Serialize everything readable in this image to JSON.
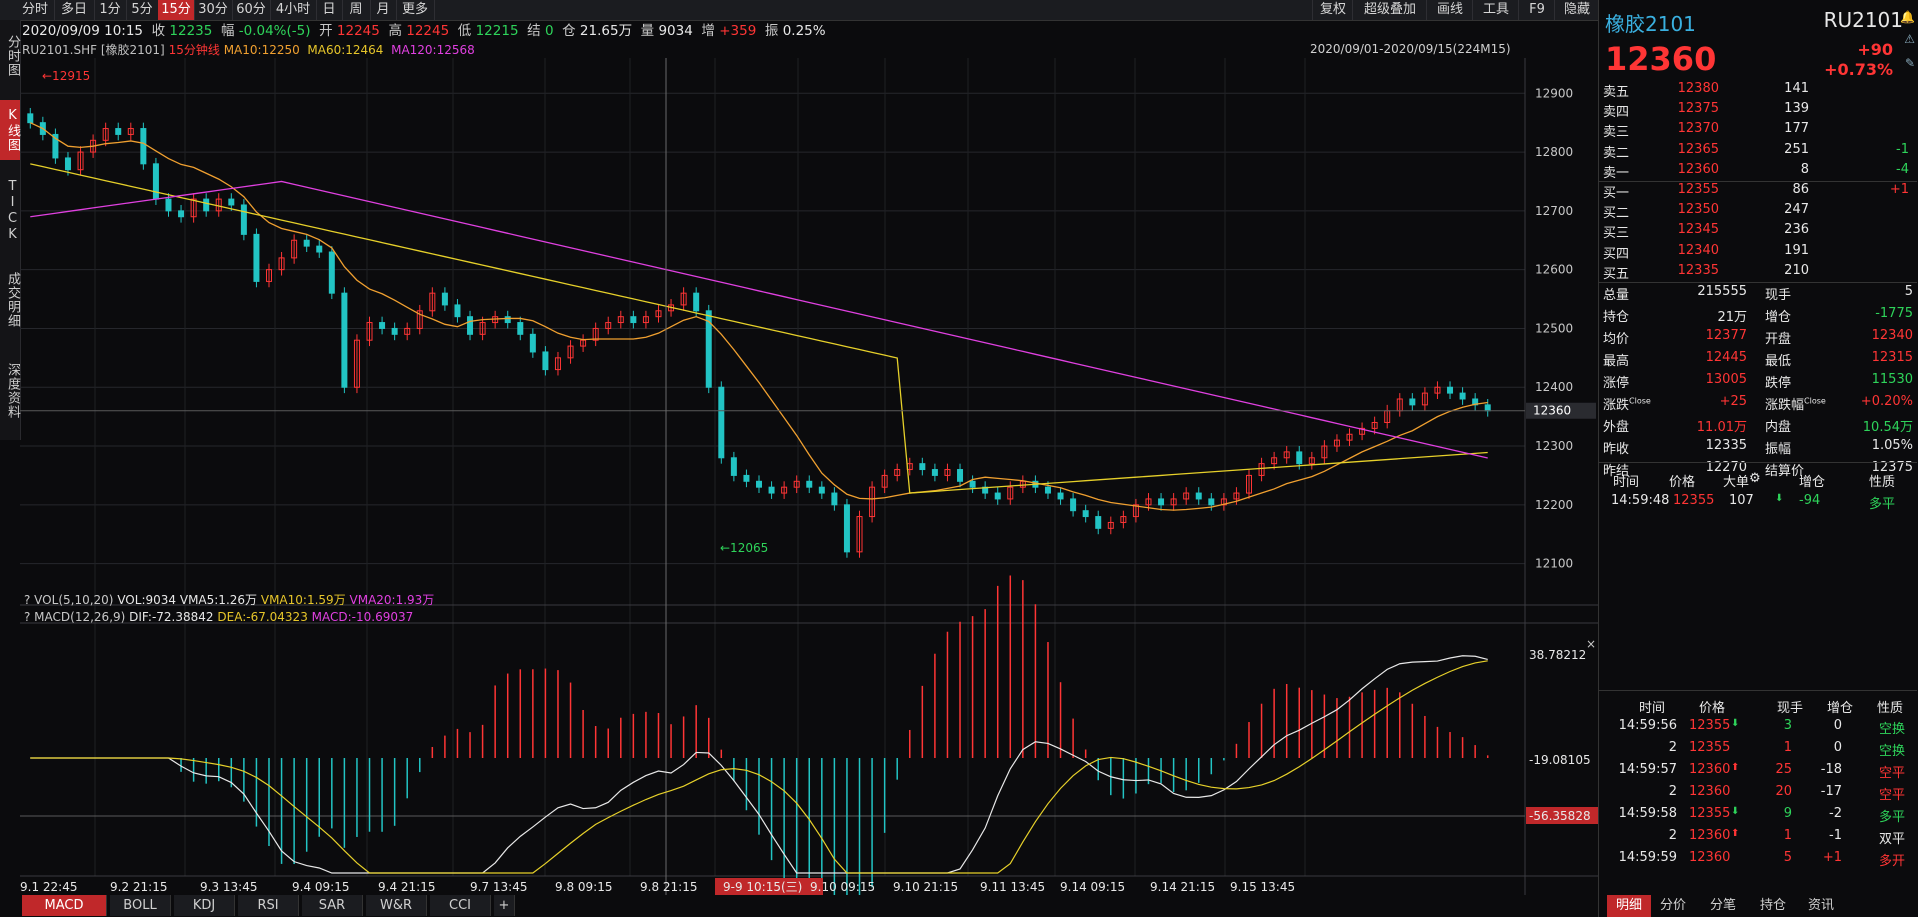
{
  "toolbar": {
    "periods": [
      "分时",
      "多日",
      "1分",
      "5分",
      "15分",
      "30分",
      "60分",
      "4小时",
      "日",
      "周",
      "月",
      "更多"
    ],
    "active_period": "15分",
    "right_buttons": [
      "复权",
      "超级叠加",
      "画线",
      "工具",
      "F9",
      "隐藏"
    ]
  },
  "quote": {
    "datetime": "2020/09/09 10:15",
    "close_label": "收",
    "close": "12235",
    "range_label": "幅",
    "change": "-0.04%(-5)",
    "open_label": "开",
    "open": "12245",
    "high_label": "高",
    "high": "12245",
    "low_label": "低",
    "low": "12215",
    "settle_label": "结",
    "settle": "0",
    "oi_label": "仓",
    "oi": "21.65万",
    "vol_label": "量",
    "vol": "9034",
    "inc_label": "增",
    "inc": "+359",
    "amp_label": "振",
    "amp": "0.25%"
  },
  "legend": {
    "symbol": "RU2101.SHF [橡胶2101]",
    "period": "15分钟线",
    "ma10": "MA10:12250",
    "ma60": "MA60:12464",
    "ma120": "MA120:12568",
    "range": "2020/09/01-2020/09/15(224M15)"
  },
  "vtabs": [
    "分时图",
    "K线图",
    "TICK",
    "成交明细",
    "深度资料"
  ],
  "vol_legend": {
    "name": "VOL(5,10,20)",
    "vol": "VOL:9034",
    "vma5": "VMA5:1.26万",
    "vma10": "VMA10:1.59万",
    "vma20": "VMA20:1.93万"
  },
  "macd_legend": {
    "name": "MACD(12,26,9)",
    "dif": "DIF:-72.38842",
    "dea": "DEA:-67.04323",
    "macd": "MACD:-10.69037"
  },
  "colors": {
    "up": "#ff3535",
    "down": "#22c4c4",
    "ma10": "#f0a030",
    "ma60": "#e6d02a",
    "ma120": "#e040e0",
    "accent": "#c0282a"
  },
  "chart_data": {
    "type": "candlestick",
    "price_axis": {
      "min": 12050,
      "max": 12960,
      "ticks": [
        12900,
        12800,
        12700,
        12600,
        12500,
        12400,
        12300,
        12200,
        12100
      ]
    },
    "current_price_tag": "12360",
    "high_annotation": "12915",
    "low_annotation": "12065",
    "macd_axis": {
      "ticks": [
        "38.78212",
        "-19.08105",
        "-56.35828"
      ]
    },
    "x_labels": [
      "9.1 22:45",
      "9.2 21:15",
      "9.3 13:45",
      "9.4 09:15",
      "9.4 21:15",
      "9.7 13:45",
      "9.8 09:15",
      "9.8 21:15",
      "9-9 10:15(三)",
      "9.10 09:15",
      "9.10 21:15",
      "9.11 13:45",
      "9.14 09:15",
      "9.14 21:15",
      "9.15 13:45"
    ],
    "closes": [
      12850,
      12830,
      12790,
      12770,
      12800,
      12820,
      12840,
      12830,
      12840,
      12780,
      12720,
      12700,
      12690,
      12720,
      12700,
      12720,
      12710,
      12660,
      12580,
      12600,
      12620,
      12650,
      12640,
      12630,
      12560,
      12400,
      12480,
      12510,
      12500,
      12490,
      12500,
      12530,
      12560,
      12540,
      12520,
      12490,
      12510,
      12520,
      12510,
      12490,
      12460,
      12430,
      12450,
      12470,
      12480,
      12500,
      12510,
      12520,
      12510,
      12520,
      12530,
      12540,
      12560,
      12530,
      12400,
      12280,
      12250,
      12240,
      12230,
      12220,
      12230,
      12240,
      12230,
      12220,
      12200,
      12120,
      12180,
      12230,
      12250,
      12260,
      12270,
      12260,
      12250,
      12260,
      12240,
      12230,
      12220,
      12210,
      12230,
      12240,
      12230,
      12220,
      12210,
      12190,
      12180,
      12160,
      12170,
      12180,
      12200,
      12210,
      12200,
      12210,
      12220,
      12210,
      12200,
      12210,
      12220,
      12250,
      12270,
      12280,
      12290,
      12270,
      12280,
      12300,
      12310,
      12320,
      12330,
      12340,
      12360,
      12380,
      12370,
      12390,
      12400,
      12390,
      12380,
      12370,
      12360
    ]
  },
  "right_panel": {
    "name": "橡胶2101",
    "code": "RU2101",
    "last": "12360",
    "change": "+90",
    "change_pct": "+0.73%",
    "asks": [
      {
        "label": "卖五",
        "price": "12380",
        "qty": "141",
        "chg": ""
      },
      {
        "label": "卖四",
        "price": "12375",
        "qty": "139",
        "chg": ""
      },
      {
        "label": "卖三",
        "price": "12370",
        "qty": "177",
        "chg": ""
      },
      {
        "label": "卖二",
        "price": "12365",
        "qty": "251",
        "chg": "-1"
      },
      {
        "label": "卖一",
        "price": "12360",
        "qty": "8",
        "chg": "-4"
      }
    ],
    "bids": [
      {
        "label": "买一",
        "price": "12355",
        "qty": "86",
        "chg": "+1"
      },
      {
        "label": "买二",
        "price": "12350",
        "qty": "247",
        "chg": ""
      },
      {
        "label": "买三",
        "price": "12345",
        "qty": "236",
        "chg": ""
      },
      {
        "label": "买四",
        "price": "12340",
        "qty": "191",
        "chg": ""
      },
      {
        "label": "买五",
        "price": "12335",
        "qty": "210",
        "chg": ""
      }
    ],
    "stats": [
      {
        "l1": "总量",
        "v1": "215555",
        "c1": "white",
        "l2": "现手",
        "v2": "5",
        "c2": "white"
      },
      {
        "l1": "持仓",
        "v1": "21万",
        "c1": "white",
        "l2": "增仓",
        "v2": "-1775",
        "c2": "green"
      },
      {
        "l1": "均价",
        "v1": "12377",
        "c1": "red",
        "l2": "开盘",
        "v2": "12340",
        "c2": "red"
      },
      {
        "l1": "最高",
        "v1": "12445",
        "c1": "red",
        "l2": "最低",
        "v2": "12315",
        "c2": "red"
      },
      {
        "l1": "涨停",
        "v1": "13005",
        "c1": "red",
        "l2": "跌停",
        "v2": "11530",
        "c2": "green"
      },
      {
        "l1": "涨跌",
        "v1": "+25",
        "c1": "red",
        "l2": "涨跌幅",
        "v2": "+0.20%",
        "c2": "red"
      },
      {
        "l1": "外盘",
        "v1": "11.01万",
        "c1": "red",
        "l2": "内盘",
        "v2": "10.54万",
        "c2": "green"
      },
      {
        "l1": "昨收",
        "v1": "12335",
        "c1": "white",
        "l2": "振幅",
        "v2": "1.05%",
        "c2": "white"
      },
      {
        "l1": "昨结",
        "v1": "12270",
        "c1": "white",
        "l2": "结算价",
        "v2": "12375",
        "c2": "white"
      }
    ],
    "close_sup": "Close",
    "big_order_headers": [
      "时间",
      "价格",
      "大单",
      "增仓",
      "性质"
    ],
    "big_order_row": {
      "time": "14:59:48",
      "price": "12355",
      "qty": "107",
      "inc": "-94",
      "nature": "多平"
    },
    "ticks_headers": [
      "时间",
      "价格",
      "现手",
      "增仓",
      "性质"
    ],
    "ticks": [
      {
        "time": "14:59:56",
        "price": "12355",
        "dir": "down",
        "qty": "3",
        "inc": "0",
        "nature": "空换",
        "nc": "green"
      },
      {
        "time": "2",
        "price": "12355",
        "dir": "",
        "qty": "1",
        "inc": "0",
        "nature": "空换",
        "nc": "green"
      },
      {
        "time": "14:59:57",
        "price": "12360",
        "dir": "up",
        "qty": "25",
        "inc": "-18",
        "nature": "空平",
        "nc": "red"
      },
      {
        "time": "2",
        "price": "12360",
        "dir": "",
        "qty": "20",
        "inc": "-17",
        "nature": "空平",
        "nc": "red"
      },
      {
        "time": "14:59:58",
        "price": "12355",
        "dir": "down",
        "qty": "9",
        "inc": "-2",
        "nature": "多平",
        "nc": "green"
      },
      {
        "time": "2",
        "price": "12360",
        "dir": "up",
        "qty": "1",
        "inc": "-1",
        "nature": "双平",
        "nc": "white"
      },
      {
        "time": "14:59:59",
        "price": "12360",
        "dir": "",
        "qty": "5",
        "inc": "+1",
        "nature": "多开",
        "nc": "red"
      }
    ],
    "bottom_tabs": [
      "明细",
      "分价",
      "分笔",
      "持仓",
      "资讯"
    ]
  },
  "bottom_indicators": [
    "MACD",
    "BOLL",
    "KDJ",
    "RSI",
    "SAR",
    "W&R",
    "CCI"
  ]
}
